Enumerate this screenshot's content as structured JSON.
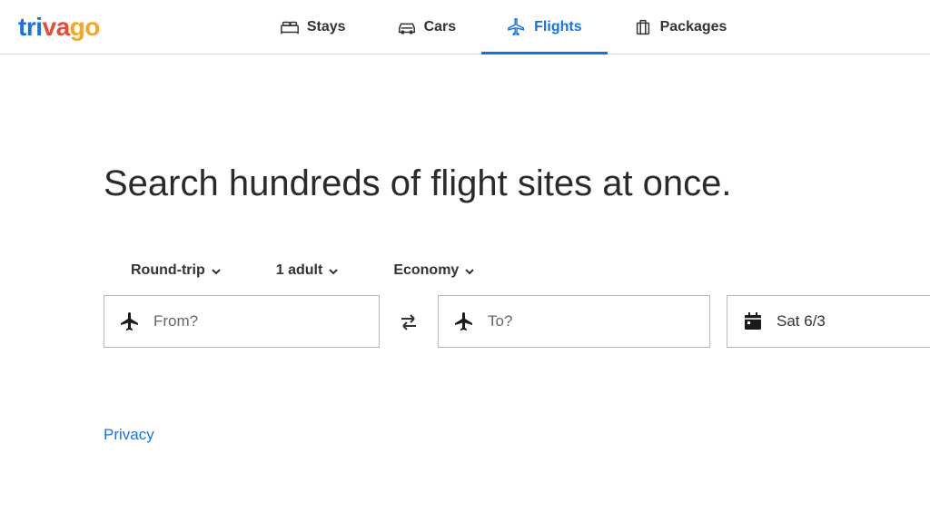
{
  "logo": {
    "part1": "tri",
    "part2": "va",
    "part3": "go"
  },
  "nav": {
    "items": [
      {
        "label": "Stays",
        "icon": "bed-icon",
        "active": false
      },
      {
        "label": "Cars",
        "icon": "car-icon",
        "active": false
      },
      {
        "label": "Flights",
        "icon": "plane-icon",
        "active": true
      },
      {
        "label": "Packages",
        "icon": "suitcase-icon",
        "active": false
      }
    ]
  },
  "headline": "Search hundreds of flight sites at once.",
  "options": {
    "trip_type": "Round-trip",
    "passengers": "1 adult",
    "cabin_class": "Economy"
  },
  "search": {
    "from_placeholder": "From?",
    "to_placeholder": "To?",
    "date_value": "Sat 6/3"
  },
  "footer": {
    "privacy_label": "Privacy"
  }
}
